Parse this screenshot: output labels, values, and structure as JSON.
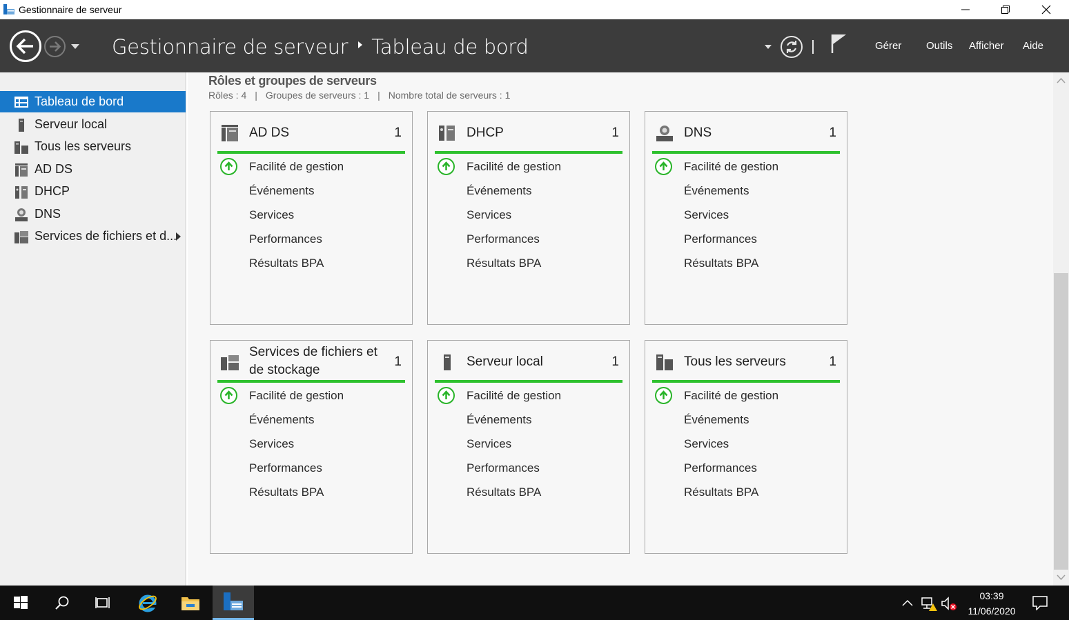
{
  "window": {
    "title": "Gestionnaire de serveur"
  },
  "header": {
    "breadcrumb_root": "Gestionnaire de serveur",
    "breadcrumb_page": "Tableau de bord",
    "menu": [
      "Gérer",
      "Outils",
      "Afficher",
      "Aide"
    ]
  },
  "sidebar": {
    "items": [
      {
        "label": "Tableau de bord",
        "icon": "dashboard-icon",
        "active": true
      },
      {
        "label": "Serveur local",
        "icon": "server-icon"
      },
      {
        "label": "Tous les serveurs",
        "icon": "servers-icon"
      },
      {
        "label": "AD DS",
        "icon": "adds-icon"
      },
      {
        "label": "DHCP",
        "icon": "dhcp-icon"
      },
      {
        "label": "DNS",
        "icon": "dns-icon"
      },
      {
        "label": "Services de fichiers et d...",
        "icon": "file-services-icon"
      }
    ]
  },
  "section": {
    "title": "Rôles et groupes de serveurs",
    "roles": "Rôles : 4",
    "groups": "Groupes de serveurs : 1",
    "total": "Nombre total de serveurs : 1",
    "separator": "|"
  },
  "tile_rows": {
    "manageability": "Facilité de gestion",
    "events": "Événements",
    "services": "Services",
    "performance": "Performances",
    "bpa": "Résultats BPA"
  },
  "tiles": [
    {
      "name": "AD DS",
      "count": "1",
      "icon": "adds-icon"
    },
    {
      "name": "DHCP",
      "count": "1",
      "icon": "dhcp-icon"
    },
    {
      "name": "DNS",
      "count": "1",
      "icon": "dns-icon"
    },
    {
      "name": "Services de fichiers et de stockage",
      "count": "1",
      "icon": "file-services-icon"
    },
    {
      "name": "Serveur local",
      "count": "1",
      "icon": "server-icon"
    },
    {
      "name": "Tous les serveurs",
      "count": "1",
      "icon": "servers-icon"
    }
  ],
  "taskbar": {
    "time": "03:39",
    "date": "11/06/2020"
  },
  "colors": {
    "header_bg": "#3c3c3c",
    "accent": "#1979ca",
    "status_green": "#2ec12e",
    "taskbar_bg": "#101010"
  }
}
